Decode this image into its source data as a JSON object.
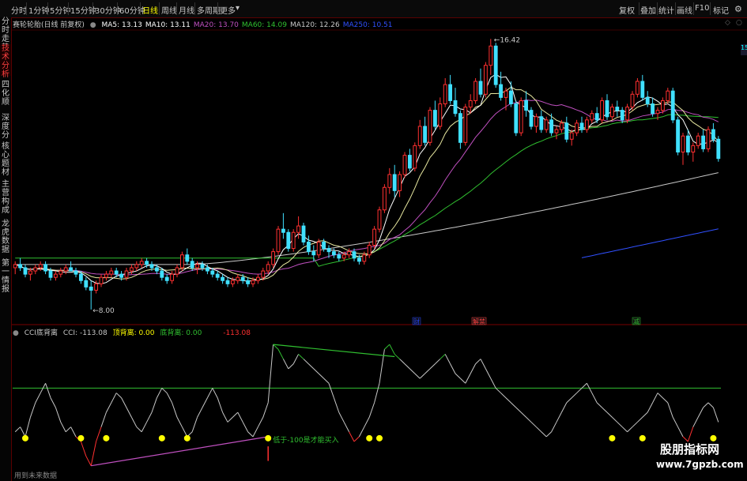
{
  "toolbar": {
    "periods": [
      "分时",
      "1分钟",
      "5分钟",
      "15分钟",
      "30分钟",
      "60分钟",
      "日线",
      "周线",
      "月线",
      "多周期",
      "更多"
    ],
    "active_period": "日线",
    "more_arrow": "▾",
    "right_buttons": [
      "复权",
      "叠加",
      "统计",
      "画线",
      "F10",
      "标记"
    ],
    "gear_icon": "gear-icon"
  },
  "sidebar": {
    "tabs": [
      "分时走势",
      "技术分析",
      "四化顺",
      "深度分",
      "核心题材",
      "主营构成",
      "龙虎数据",
      "第一情报"
    ],
    "active_tab": "技术分析"
  },
  "main": {
    "title": "赛轮轮胎(日线 前复权)",
    "ma": [
      {
        "label": "MA5: 13.13",
        "color": "#ffffff"
      },
      {
        "label": "MA10: 13.11",
        "color": "#ffffff"
      },
      {
        "label": "MA20: 13.70",
        "color": "#c050c0"
      },
      {
        "label": "MA60: 14.09",
        "color": "#30c030"
      },
      {
        "label": "MA120: 12.26",
        "color": "#c8c8c8"
      },
      {
        "label": "MA250: 10.51",
        "color": "#3050ff"
      }
    ],
    "high_label": "16.42",
    "low_label": "8.00",
    "right_tag": "15",
    "events": [
      "财",
      "解禁",
      "减"
    ]
  },
  "cci": {
    "title": "CCI底背离",
    "cci_value": "CCI: -113.08",
    "top_div": "顶背离: 0.00",
    "bottom_div": "底背离: 0.00",
    "neg_value": "-113.08",
    "annotation": "低于-100是才能买入"
  },
  "footer": {
    "text": "用到未来数据"
  },
  "watermark": {
    "line1": "股朋指标网",
    "line2": "www.7gpzb.com"
  },
  "colors": {
    "up": "#ff3030",
    "down": "#40e0ff",
    "green": "#30c030",
    "yellow": "#ffff00"
  },
  "chart_data": {
    "type": "candlestick",
    "ohlc": [
      [
        9.3,
        9.5,
        9.1,
        9.4
      ],
      [
        9.4,
        9.6,
        9.2,
        9.3
      ],
      [
        9.3,
        9.4,
        9.0,
        9.1
      ],
      [
        9.1,
        9.3,
        8.9,
        9.2
      ],
      [
        9.2,
        9.4,
        9.1,
        9.3
      ],
      [
        9.3,
        9.5,
        9.2,
        9.4
      ],
      [
        9.4,
        9.5,
        9.1,
        9.2
      ],
      [
        9.2,
        9.3,
        8.9,
        9.0
      ],
      [
        9.0,
        9.2,
        8.9,
        9.1
      ],
      [
        9.1,
        9.3,
        9.0,
        9.2
      ],
      [
        9.2,
        9.4,
        9.1,
        9.3
      ],
      [
        9.3,
        9.5,
        9.2,
        9.2
      ],
      [
        9.2,
        9.3,
        9.0,
        9.1
      ],
      [
        9.1,
        9.2,
        8.8,
        8.9
      ],
      [
        8.9,
        9.0,
        8.6,
        8.7
      ],
      [
        8.7,
        8.9,
        8.0,
        8.6
      ],
      [
        8.6,
        8.9,
        8.5,
        8.8
      ],
      [
        8.8,
        9.1,
        8.7,
        9.0
      ],
      [
        9.0,
        9.2,
        8.9,
        9.1
      ],
      [
        9.1,
        9.3,
        9.0,
        9.2
      ],
      [
        9.2,
        9.3,
        9.0,
        9.1
      ],
      [
        9.1,
        9.2,
        8.9,
        9.0
      ],
      [
        9.0,
        9.3,
        8.9,
        9.2
      ],
      [
        9.2,
        9.4,
        9.1,
        9.3
      ],
      [
        9.3,
        9.5,
        9.2,
        9.4
      ],
      [
        9.4,
        9.6,
        9.3,
        9.5
      ],
      [
        9.5,
        9.6,
        9.3,
        9.4
      ],
      [
        9.4,
        9.5,
        9.2,
        9.3
      ],
      [
        9.3,
        9.4,
        9.1,
        9.2
      ],
      [
        9.2,
        9.3,
        8.9,
        9.0
      ],
      [
        9.0,
        9.1,
        8.8,
        8.9
      ],
      [
        8.9,
        9.2,
        8.8,
        9.1
      ],
      [
        9.1,
        9.4,
        9.0,
        9.3
      ],
      [
        9.3,
        9.8,
        9.2,
        9.7
      ],
      [
        9.7,
        9.9,
        9.4,
        9.5
      ],
      [
        9.5,
        9.6,
        9.2,
        9.3
      ],
      [
        9.3,
        9.5,
        9.1,
        9.4
      ],
      [
        9.4,
        9.5,
        9.2,
        9.3
      ],
      [
        9.3,
        9.4,
        9.1,
        9.2
      ],
      [
        9.2,
        9.3,
        9.0,
        9.1
      ],
      [
        9.1,
        9.2,
        8.9,
        9.0
      ],
      [
        9.0,
        9.1,
        8.8,
        8.9
      ],
      [
        8.9,
        9.0,
        8.7,
        8.8
      ],
      [
        8.8,
        9.0,
        8.7,
        8.9
      ],
      [
        8.9,
        9.1,
        8.8,
        9.0
      ],
      [
        9.0,
        9.1,
        8.8,
        8.9
      ],
      [
        8.9,
        9.0,
        8.7,
        8.8
      ],
      [
        8.8,
        9.0,
        8.7,
        8.9
      ],
      [
        8.9,
        9.1,
        8.8,
        9.0
      ],
      [
        9.0,
        9.3,
        8.9,
        9.2
      ],
      [
        9.2,
        9.5,
        9.1,
        9.4
      ],
      [
        9.4,
        9.9,
        9.3,
        9.8
      ],
      [
        9.8,
        10.6,
        9.7,
        10.5
      ],
      [
        10.5,
        11.0,
        10.2,
        10.4
      ],
      [
        10.4,
        10.5,
        9.8,
        9.9
      ],
      [
        9.9,
        10.5,
        9.8,
        10.4
      ],
      [
        10.4,
        10.9,
        10.2,
        10.6
      ],
      [
        10.6,
        10.7,
        10.0,
        10.1
      ],
      [
        10.1,
        10.3,
        9.7,
        9.8
      ],
      [
        9.8,
        10.0,
        9.5,
        9.7
      ],
      [
        9.7,
        10.2,
        9.6,
        10.1
      ],
      [
        10.1,
        10.2,
        9.8,
        9.9
      ],
      [
        9.9,
        10.0,
        9.6,
        9.8
      ],
      [
        9.8,
        9.9,
        9.6,
        9.7
      ],
      [
        9.7,
        9.8,
        9.5,
        9.6
      ],
      [
        9.6,
        9.8,
        9.5,
        9.7
      ],
      [
        9.7,
        9.9,
        9.6,
        9.8
      ],
      [
        9.8,
        9.9,
        9.5,
        9.6
      ],
      [
        9.6,
        9.7,
        9.4,
        9.5
      ],
      [
        9.5,
        9.8,
        9.4,
        9.7
      ],
      [
        9.7,
        10.1,
        9.6,
        10.0
      ],
      [
        10.0,
        10.6,
        9.9,
        10.5
      ],
      [
        10.5,
        11.2,
        10.4,
        11.1
      ],
      [
        11.1,
        11.9,
        11.0,
        11.8
      ],
      [
        11.8,
        12.4,
        11.6,
        12.2
      ],
      [
        12.2,
        12.5,
        11.5,
        11.7
      ],
      [
        11.7,
        12.3,
        11.5,
        12.2
      ],
      [
        12.2,
        12.9,
        12.1,
        12.8
      ],
      [
        12.8,
        13.0,
        12.3,
        12.4
      ],
      [
        12.4,
        13.2,
        12.3,
        13.1
      ],
      [
        13.1,
        13.9,
        13.0,
        13.7
      ],
      [
        13.7,
        14.0,
        13.1,
        13.2
      ],
      [
        13.2,
        14.3,
        13.1,
        14.2
      ],
      [
        14.2,
        14.5,
        13.6,
        13.7
      ],
      [
        13.7,
        14.6,
        13.6,
        14.4
      ],
      [
        14.4,
        15.2,
        14.3,
        15.0
      ],
      [
        15.0,
        15.3,
        14.4,
        14.5
      ],
      [
        14.5,
        14.9,
        14.0,
        14.1
      ],
      [
        14.1,
        14.2,
        13.0,
        13.2
      ],
      [
        13.2,
        14.4,
        13.1,
        14.3
      ],
      [
        14.3,
        14.7,
        14.1,
        14.5
      ],
      [
        14.5,
        15.2,
        14.4,
        15.1
      ],
      [
        15.1,
        15.5,
        14.6,
        14.7
      ],
      [
        14.7,
        15.7,
        14.6,
        15.6
      ],
      [
        15.6,
        16.42,
        15.3,
        16.2
      ],
      [
        16.2,
        16.3,
        14.9,
        15.0
      ],
      [
        15.0,
        15.4,
        14.5,
        14.6
      ],
      [
        14.6,
        14.9,
        14.2,
        14.8
      ],
      [
        14.8,
        15.1,
        14.3,
        14.4
      ],
      [
        14.4,
        14.5,
        13.4,
        13.5
      ],
      [
        13.5,
        14.6,
        13.4,
        14.5
      ],
      [
        14.5,
        14.8,
        14.0,
        14.2
      ],
      [
        14.2,
        14.3,
        13.6,
        13.7
      ],
      [
        13.7,
        14.1,
        13.5,
        14.0
      ],
      [
        14.0,
        14.2,
        13.5,
        13.6
      ],
      [
        13.6,
        14.0,
        13.5,
        13.9
      ],
      [
        13.9,
        14.1,
        13.4,
        13.5
      ],
      [
        13.5,
        13.7,
        13.3,
        13.6
      ],
      [
        13.6,
        13.9,
        13.5,
        13.8
      ],
      [
        13.8,
        14.0,
        13.2,
        13.3
      ],
      [
        13.3,
        13.6,
        13.1,
        13.5
      ],
      [
        13.5,
        13.9,
        13.4,
        13.8
      ],
      [
        13.8,
        14.0,
        13.5,
        13.6
      ],
      [
        13.6,
        14.0,
        13.5,
        13.9
      ],
      [
        13.9,
        14.2,
        13.8,
        14.1
      ],
      [
        14.1,
        14.3,
        13.8,
        13.9
      ],
      [
        13.9,
        14.6,
        13.8,
        14.5
      ],
      [
        14.5,
        14.7,
        13.9,
        14.0
      ],
      [
        14.0,
        14.4,
        13.9,
        14.3
      ],
      [
        14.3,
        14.5,
        14.0,
        14.2
      ],
      [
        14.2,
        14.3,
        13.8,
        13.9
      ],
      [
        13.9,
        14.4,
        13.8,
        14.3
      ],
      [
        14.3,
        14.8,
        14.2,
        14.7
      ],
      [
        14.7,
        15.2,
        14.6,
        15.1
      ],
      [
        15.1,
        15.3,
        14.5,
        14.6
      ],
      [
        14.6,
        14.8,
        14.3,
        14.4
      ],
      [
        14.4,
        14.6,
        14.0,
        14.1
      ],
      [
        14.1,
        14.3,
        13.9,
        14.2
      ],
      [
        14.2,
        14.6,
        14.1,
        14.5
      ],
      [
        14.5,
        14.9,
        14.4,
        14.8
      ],
      [
        14.8,
        14.9,
        13.8,
        13.9
      ],
      [
        13.9,
        14.0,
        12.8,
        12.9
      ],
      [
        12.9,
        13.5,
        12.5,
        13.4
      ],
      [
        13.4,
        13.6,
        12.8,
        12.9
      ],
      [
        12.9,
        13.2,
        12.6,
        13.1
      ],
      [
        13.1,
        13.5,
        13.0,
        13.4
      ],
      [
        13.4,
        13.6,
        12.9,
        13.0
      ],
      [
        13.0,
        13.7,
        12.9,
        13.6
      ],
      [
        13.6,
        13.8,
        13.2,
        13.3
      ],
      [
        13.3,
        13.4,
        12.6,
        12.7
      ]
    ],
    "ma_names": [
      "MA5",
      "MA10",
      "MA20",
      "MA60",
      "MA120",
      "MA250"
    ],
    "ma60_last": 14.09,
    "ma120_last": 12.26,
    "ma250_last": 10.51,
    "price_high": 16.42,
    "price_low": 8.0,
    "cci_last": -113.08,
    "cci_buy_level": -100,
    "cci": [
      -80,
      -60,
      -100,
      -20,
      40,
      80,
      120,
      60,
      20,
      -40,
      -80,
      -60,
      -100,
      -120,
      -180,
      -220,
      -120,
      -60,
      0,
      40,
      80,
      60,
      20,
      -20,
      -60,
      -80,
      -40,
      0,
      60,
      100,
      80,
      40,
      -20,
      -60,
      -100,
      -80,
      -20,
      20,
      60,
      100,
      60,
      0,
      -40,
      -20,
      0,
      -40,
      -80,
      -100,
      -60,
      -20,
      40,
      280,
      260,
      220,
      180,
      200,
      240,
      220,
      200,
      180,
      160,
      140,
      120,
      60,
      0,
      -40,
      -80,
      -120,
      -100,
      -60,
      -20,
      40,
      120,
      260,
      280,
      240,
      220,
      200,
      180,
      160,
      140,
      160,
      180,
      200,
      220,
      240,
      200,
      160,
      140,
      120,
      160,
      200,
      220,
      180,
      140,
      100,
      80,
      60,
      40,
      20,
      0,
      -20,
      -40,
      -60,
      -80,
      -100,
      -80,
      -40,
      0,
      40,
      60,
      80,
      100,
      120,
      80,
      40,
      20,
      0,
      -20,
      -40,
      -60,
      -80,
      -60,
      -40,
      -20,
      0,
      40,
      80,
      60,
      40,
      -20,
      -60,
      -100,
      -120,
      -60,
      -20,
      20,
      40,
      20,
      -40
    ]
  }
}
